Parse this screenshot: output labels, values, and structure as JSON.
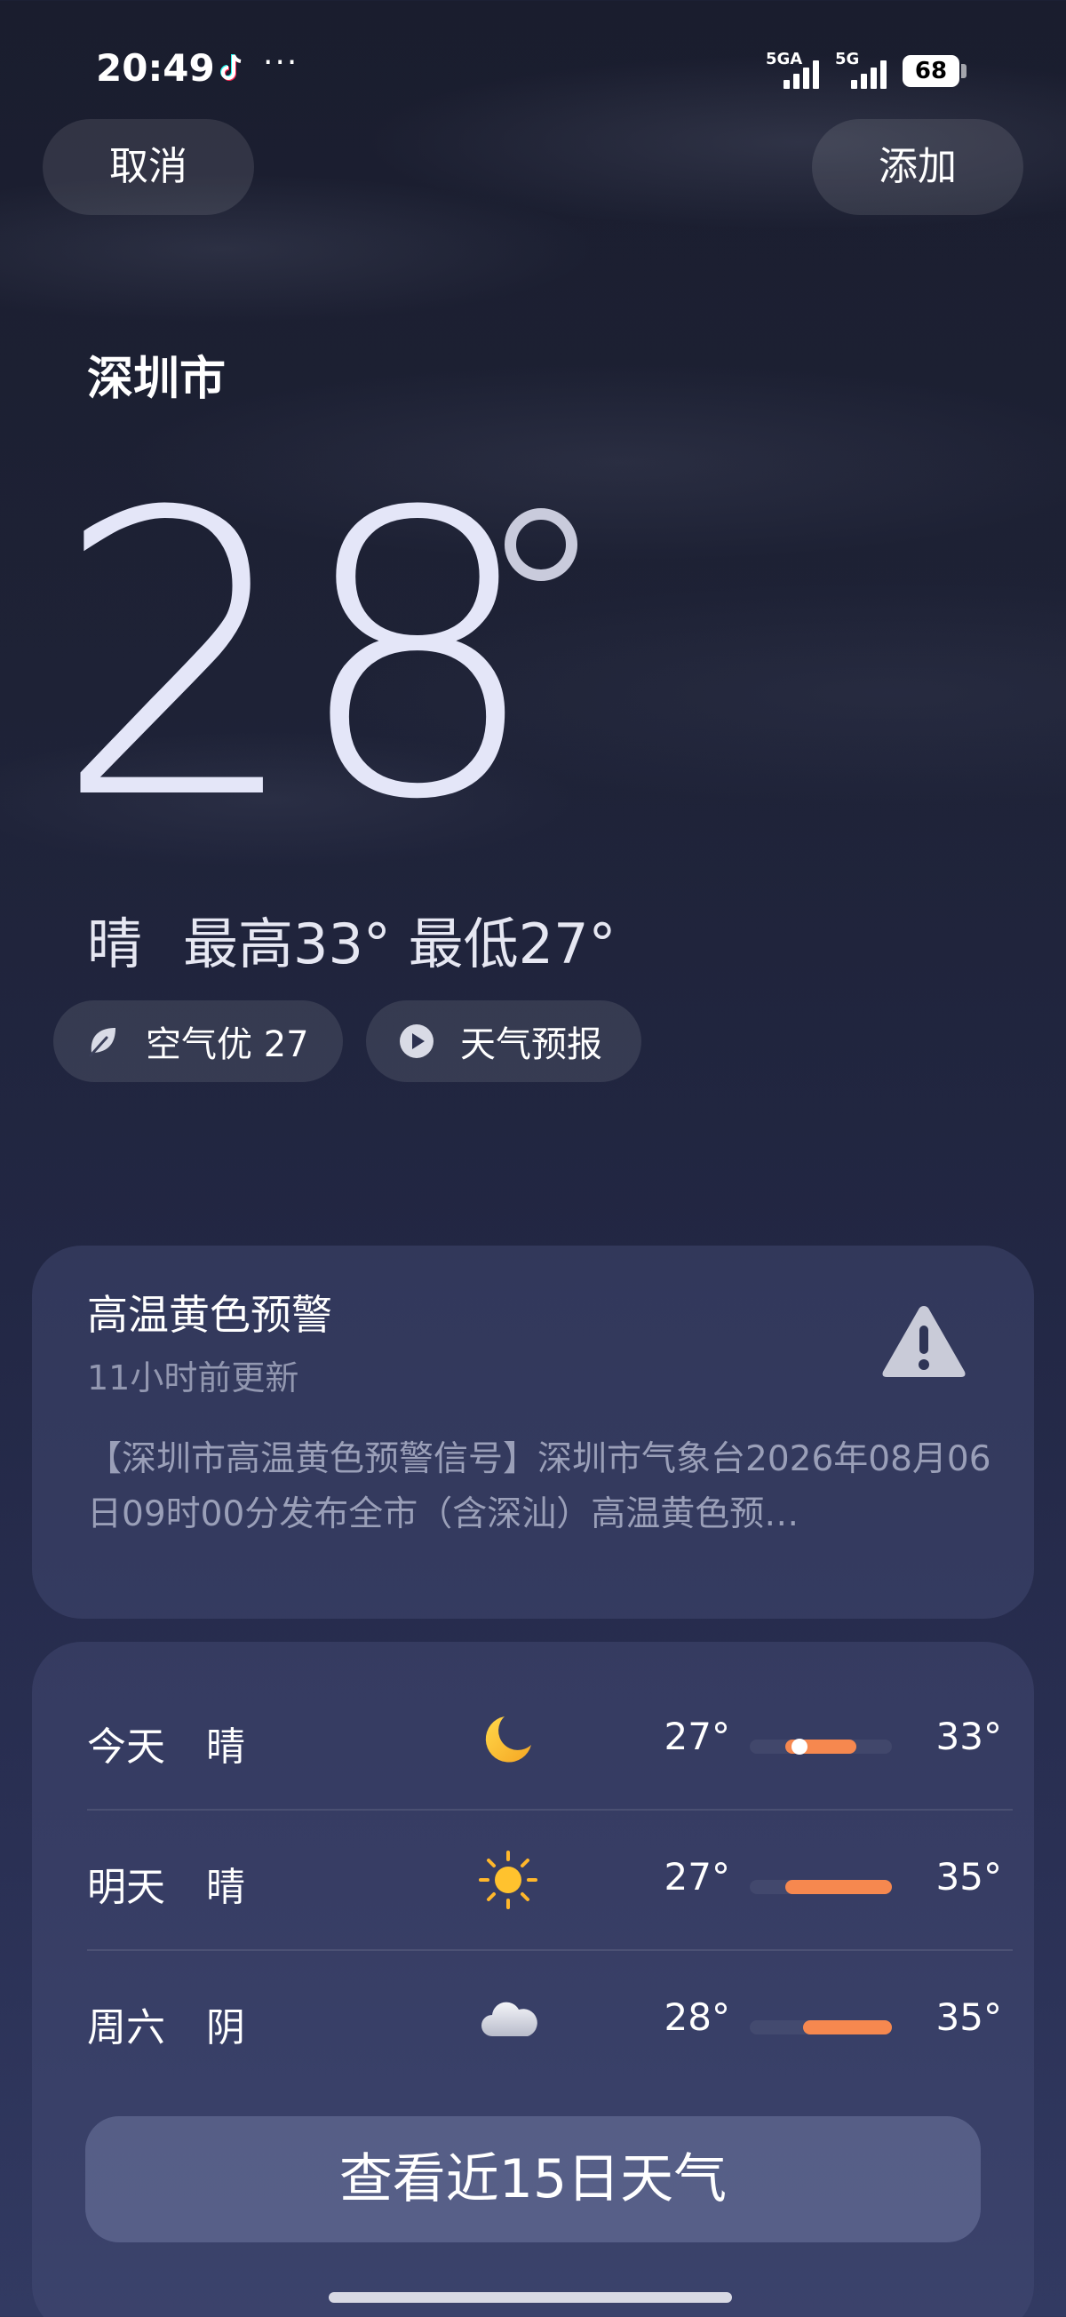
{
  "status": {
    "time": "20:49",
    "more": "···",
    "sim1": "5GA",
    "sim2": "5G",
    "battery": "68"
  },
  "header": {
    "cancel_label": "取消",
    "add_label": "添加"
  },
  "weather": {
    "city": "深圳市",
    "temperature": "28",
    "condition": "晴",
    "high_low": "最高33° 最低27°"
  },
  "chips": {
    "aqi": "空气优 27",
    "forecast_video": "天气预报"
  },
  "warning": {
    "title": "高温黄色预警",
    "updated": "11小时前更新",
    "text": "【深圳市高温黄色预警信号】深圳市气象台2026年08月06日09时00分发布全市（含深汕）高温黄色预…"
  },
  "forecast": {
    "days": [
      {
        "day": "今天",
        "condition": "晴",
        "icon": "moon-icon",
        "low": "27°",
        "high": "33°",
        "range_start": 0.25,
        "range_end": 0.75,
        "current": 0.35
      },
      {
        "day": "明天",
        "condition": "晴",
        "icon": "sun-icon",
        "low": "27°",
        "high": "35°",
        "range_start": 0.25,
        "range_end": 1.0
      },
      {
        "day": "周六",
        "condition": "阴",
        "icon": "cloud-icon",
        "low": "28°",
        "high": "35°",
        "range_start": 0.375,
        "range_end": 1.0
      }
    ],
    "more_label": "查看近15日天气"
  },
  "colors": {
    "accent_bar": "#f6884f",
    "card_bg": "#3a4170"
  }
}
